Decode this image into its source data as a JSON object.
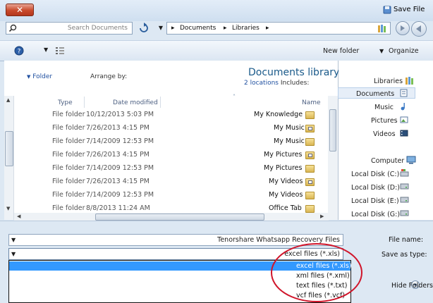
{
  "window": {
    "title": "Save File",
    "close_glyph": "✕"
  },
  "address": {
    "search_placeholder": "Search Documents",
    "crumbs": [
      "Libraries",
      "Documents"
    ],
    "crumb_sep": "▸"
  },
  "toolbar": {
    "organize": "Organize",
    "new_folder": "New folder"
  },
  "nav": {
    "libraries": "Libraries",
    "documents": "Documents",
    "music": "Music",
    "pictures": "Pictures",
    "videos": "Videos",
    "computer": "Computer",
    "disks": [
      "Local Disk (C:)",
      "Local Disk (D:)",
      "Local Disk (E:)",
      "Local Disk (G:)"
    ]
  },
  "library": {
    "title": "Documents library",
    "includes_label": "Includes:",
    "includes_link": "2 locations",
    "arrange_label": "Arrange by:",
    "arrange_value": "Folder"
  },
  "columns": {
    "name": "Name",
    "date": "Date modified",
    "type": "Type"
  },
  "files": [
    {
      "name": "My Knowledge",
      "date": "10/12/2013 5:03 PM",
      "type": "File folder"
    },
    {
      "name": "My Music",
      "date": "7/26/2013 4:15 PM",
      "type": "File folder"
    },
    {
      "name": "My Music",
      "date": "7/14/2009 12:53 PM",
      "type": "File folder"
    },
    {
      "name": "My Pictures",
      "date": "7/26/2013 4:15 PM",
      "type": "File folder"
    },
    {
      "name": "My Pictures",
      "date": "7/14/2009 12:53 PM",
      "type": "File folder"
    },
    {
      "name": "My Videos",
      "date": "7/26/2013 4:15 PM",
      "type": "File folder"
    },
    {
      "name": "My Videos",
      "date": "7/14/2009 12:53 PM",
      "type": "File folder"
    },
    {
      "name": "Office Tab",
      "date": "8/8/2013 11:24 AM",
      "type": "File folder"
    }
  ],
  "bottom": {
    "file_name_label": "File name:",
    "file_name_value": "Tenorshare Whatsapp Recovery Files",
    "save_type_label": "Save as type:",
    "save_type_value": "excel files (*.xls)",
    "options": [
      "excel files (*.xls)",
      "xml files (*.xml)",
      "text files (*.txt)",
      "vcf files (*.vcf)"
    ],
    "hide_folders": "Hide Folders"
  },
  "colors": {
    "accent": "#3399ff",
    "highlight_ellipse": "#d0152a",
    "title_blue": "#1a5a8a"
  }
}
